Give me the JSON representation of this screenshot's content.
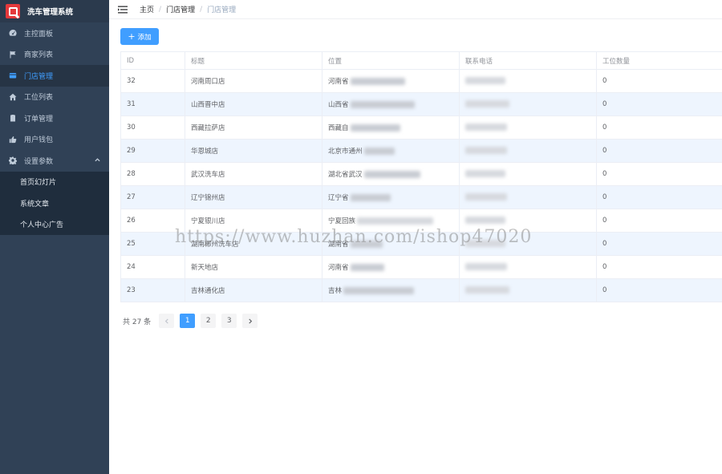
{
  "app": {
    "title": "洗车管理系统",
    "accent_color": "#409eff",
    "sidebar_bg": "#304156"
  },
  "sidebar": {
    "items": [
      {
        "label": "主控面板",
        "icon": "dashboard-icon"
      },
      {
        "label": "商家列表",
        "icon": "flag-icon"
      },
      {
        "label": "门店管理",
        "icon": "store-icon",
        "active": true
      },
      {
        "label": "工位列表",
        "icon": "home-icon"
      },
      {
        "label": "订单管理",
        "icon": "clipboard-icon"
      },
      {
        "label": "用户钱包",
        "icon": "thumbs-up-icon"
      },
      {
        "label": "设置参数",
        "icon": "gear-icon",
        "expanded": true
      }
    ],
    "submenu": [
      {
        "label": "首页幻灯片"
      },
      {
        "label": "系统文章"
      },
      {
        "label": "个人中心广告"
      }
    ]
  },
  "header": {
    "breadcrumb": [
      "主页",
      "门店管理",
      "门店管理"
    ],
    "separator": "/"
  },
  "toolbar": {
    "add_label": "添加",
    "add_icon": "+"
  },
  "table": {
    "columns": [
      "ID",
      "标题",
      "位置",
      "联系电话",
      "工位数量"
    ],
    "rows": [
      {
        "id": "32",
        "title": "河南周口店",
        "location": "河南省",
        "phone": "",
        "stations": "0"
      },
      {
        "id": "31",
        "title": "山西晋中店",
        "location": "山西省",
        "phone": "",
        "stations": "0"
      },
      {
        "id": "30",
        "title": "西藏拉萨店",
        "location": "西藏自",
        "phone": "",
        "stations": "0"
      },
      {
        "id": "29",
        "title": "华恩城店",
        "location": "北京市通州",
        "phone": "",
        "stations": "0"
      },
      {
        "id": "28",
        "title": "武汉洗车店",
        "location": "湖北省武汉",
        "phone": "",
        "stations": "0"
      },
      {
        "id": "27",
        "title": "辽宁锦州店",
        "location": "辽宁省",
        "phone": "",
        "stations": "0"
      },
      {
        "id": "26",
        "title": "宁夏银川店",
        "location": "宁夏回族",
        "phone": "",
        "stations": "0"
      },
      {
        "id": "25",
        "title": "湖南郴州洗车店",
        "location": "湖南省",
        "phone": "",
        "stations": "0"
      },
      {
        "id": "24",
        "title": "新天地店",
        "location": "河南省",
        "phone": "",
        "stations": "0"
      },
      {
        "id": "23",
        "title": "吉林通化店",
        "location": "吉林",
        "phone": "",
        "stations": "0"
      }
    ]
  },
  "pagination": {
    "total_text": "共 27 条",
    "pages": [
      "1",
      "2",
      "3"
    ],
    "current": "1"
  },
  "watermark": "https://www.huzhan.com/ishop47020"
}
